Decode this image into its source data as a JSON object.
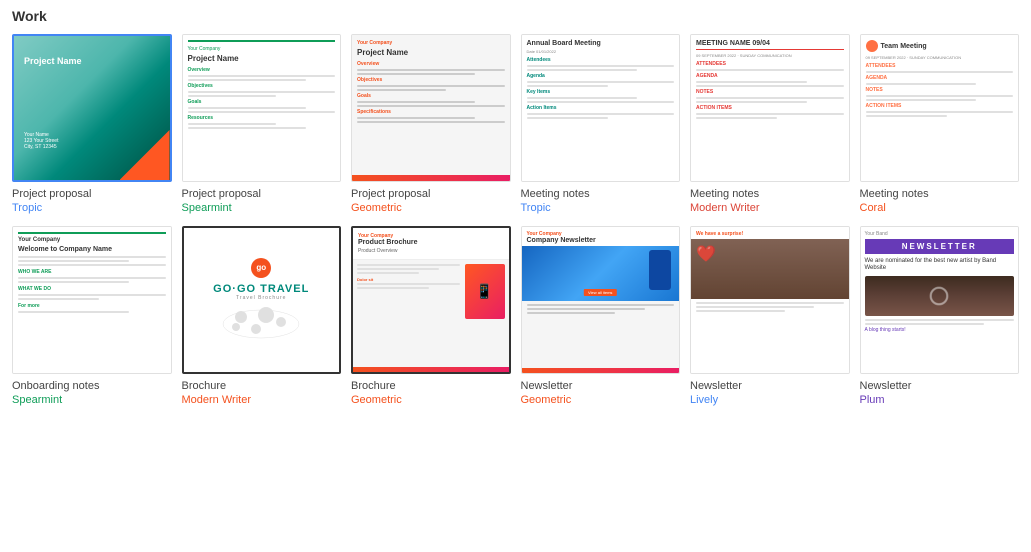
{
  "section": {
    "title": "Work"
  },
  "templates": [
    {
      "id": "project-proposal-tropic",
      "name": "Project proposal",
      "style": "Tropic",
      "style_color": "style-blue",
      "selected": true,
      "selected_type": "blue",
      "row": 1
    },
    {
      "id": "project-proposal-spearmint",
      "name": "Project proposal",
      "style": "Spearmint",
      "style_color": "style-green",
      "selected": false,
      "row": 1
    },
    {
      "id": "project-proposal-geometric",
      "name": "Project proposal",
      "style": "Geometric",
      "style_color": "style-orange",
      "selected": false,
      "row": 1
    },
    {
      "id": "meeting-notes-tropic",
      "name": "Meeting notes",
      "style": "Tropic",
      "style_color": "style-blue",
      "selected": false,
      "row": 1
    },
    {
      "id": "meeting-notes-modern-writer",
      "name": "Meeting notes",
      "style": "Modern Writer",
      "style_color": "style-red",
      "selected": false,
      "row": 1
    },
    {
      "id": "meeting-notes-coral",
      "name": "Meeting notes",
      "style": "Coral",
      "style_color": "style-coral",
      "selected": false,
      "row": 1
    },
    {
      "id": "onboarding-notes-spearmint",
      "name": "Onboarding notes",
      "style": "Spearmint",
      "style_color": "style-green",
      "selected": false,
      "row": 2
    },
    {
      "id": "brochure-modern-writer",
      "name": "Brochure",
      "style": "Modern Writer",
      "style_color": "style-orange",
      "selected": false,
      "selected_type": "black",
      "row": 2
    },
    {
      "id": "brochure-geometric",
      "name": "Brochure",
      "style": "Geometric",
      "style_color": "style-orange",
      "selected": false,
      "selected_type": "black",
      "row": 2
    },
    {
      "id": "newsletter-geometric",
      "name": "Newsletter",
      "style": "Geometric",
      "style_color": "style-orange",
      "selected": false,
      "row": 2
    },
    {
      "id": "newsletter-lively",
      "name": "Newsletter",
      "style": "Lively",
      "style_color": "style-blue",
      "selected": false,
      "row": 2
    },
    {
      "id": "newsletter-plum",
      "name": "Newsletter",
      "style": "Plum",
      "style_color": "style-purple",
      "selected": false,
      "row": 2
    }
  ]
}
